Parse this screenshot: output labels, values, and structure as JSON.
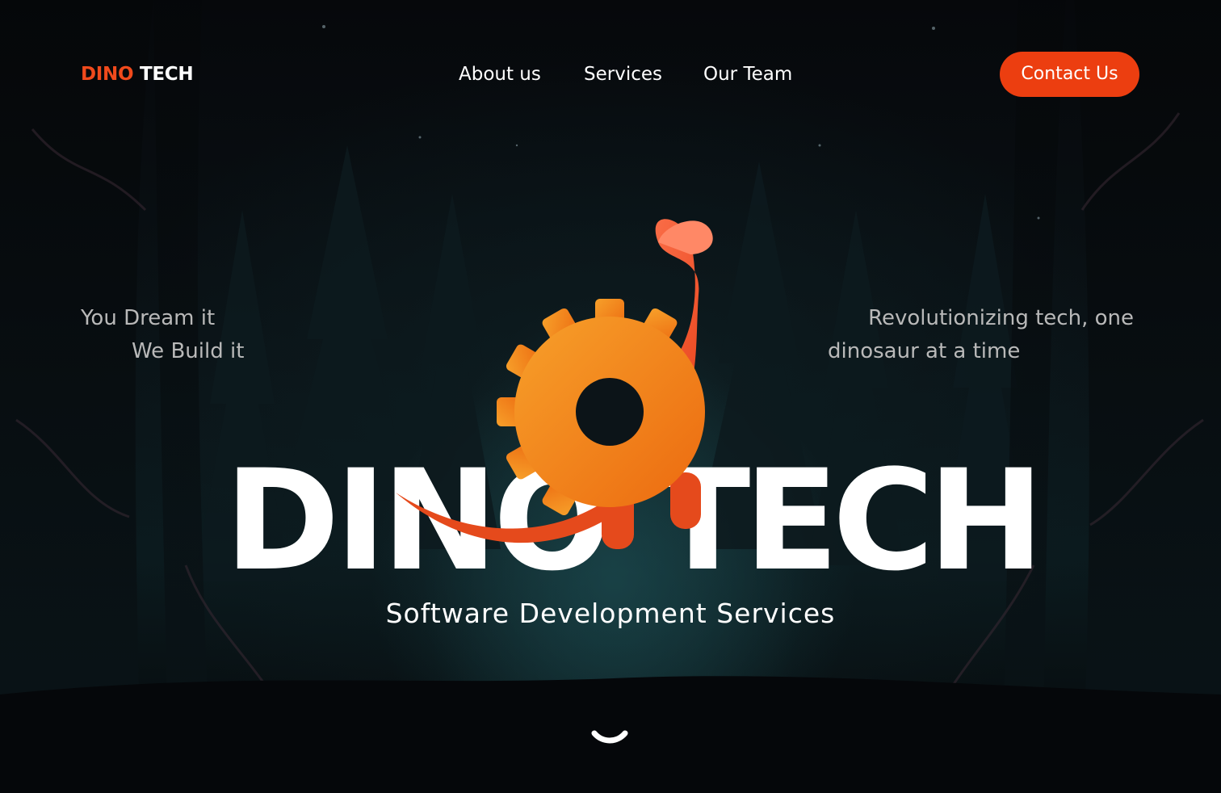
{
  "brand": {
    "part1": "DINO",
    "part2": "TECH",
    "accent_color": "#ec3e10"
  },
  "nav": {
    "items": [
      {
        "label": "About us"
      },
      {
        "label": "Services"
      },
      {
        "label": "Our Team"
      }
    ],
    "cta_label": "Contact Us"
  },
  "hero": {
    "left_tagline": [
      "You Dream it",
      "We Build it"
    ],
    "right_tagline": [
      "Revolutionizing tech, one",
      "dinosaur at a time"
    ],
    "title_word1": "DINO",
    "title_word2": "TECH",
    "subtitle": "Software Development Services"
  },
  "icons": {
    "scroll": "chevron-down-icon",
    "mascot": "dino-gear-logo",
    "background": "dark-forest-illustration"
  }
}
